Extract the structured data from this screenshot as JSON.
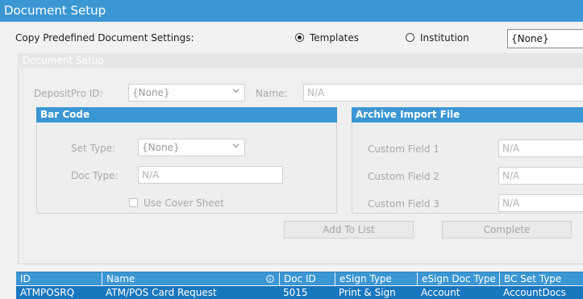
{
  "window": {
    "title": "Document Setup"
  },
  "copy_section": {
    "label": "Copy Predefined Document Settings:",
    "options": [
      {
        "label": "Templates",
        "checked": true
      },
      {
        "label": "Institution",
        "checked": false
      }
    ],
    "selected_value": "{None}"
  },
  "document_setup": {
    "header": "Document Setup",
    "depositpro_label": "DepositPro ID:",
    "depositpro_value": "{None}",
    "name_label": "Name:",
    "name_placeholder": "N/A"
  },
  "bar_code": {
    "header": "Bar Code",
    "set_type_label": "Set Type:",
    "set_type_value": "{None}",
    "doc_type_label": "Doc Type:",
    "doc_type_placeholder": "N/A",
    "cover_sheet_label": "Use Cover Sheet",
    "cover_sheet_checked": false
  },
  "archive_import": {
    "header": "Archive Import File",
    "fields": [
      {
        "label": "Custom Field 1",
        "placeholder": "N/A"
      },
      {
        "label": "Custom Field 2",
        "placeholder": "N/A"
      },
      {
        "label": "Custom Field 3",
        "placeholder": "N/A"
      }
    ]
  },
  "actions": {
    "add_to_list": "Add To List",
    "complete": "Complete"
  },
  "table": {
    "columns": [
      "ID",
      "Name",
      "Doc ID",
      "eSign Type",
      "eSign Doc Type",
      "BC Set Type"
    ],
    "rows": [
      [
        "ATMPOSRQ",
        "ATM/POS Card Request",
        "5015",
        "Print & Sign",
        "Account",
        "AccountDocs"
      ]
    ]
  },
  "icons": {
    "chevron": "chevron-down-icon",
    "info": "info-icon"
  },
  "colors": {
    "accent": "#3b97d3",
    "selected_row": "#1977bf"
  }
}
